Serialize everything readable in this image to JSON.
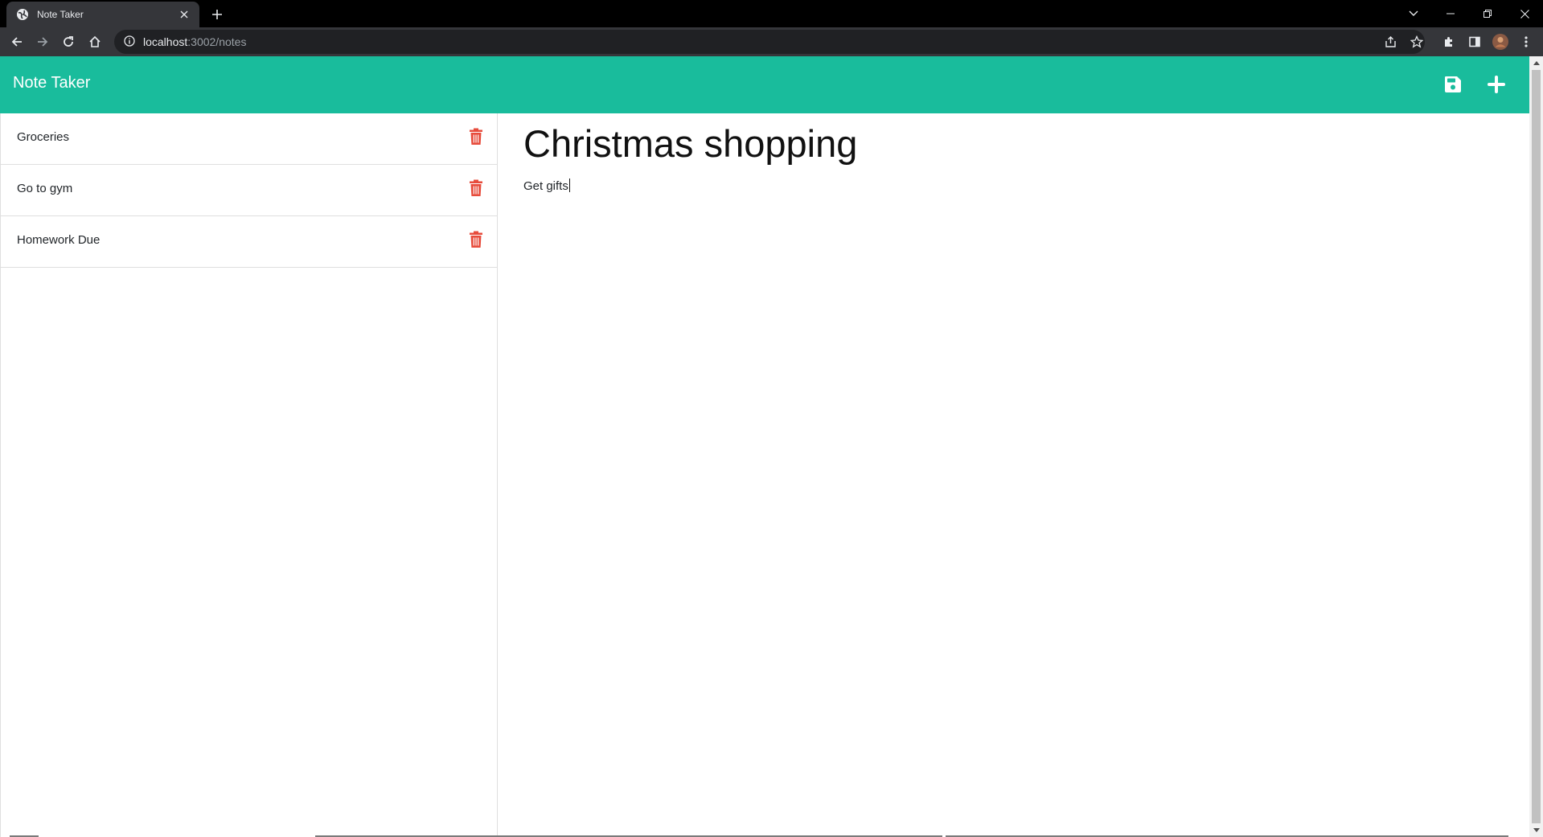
{
  "browser": {
    "tab_title": "Note Taker",
    "url_host": "localhost",
    "url_rest": ":3002/notes"
  },
  "app": {
    "brand": "Note Taker",
    "accent_color": "#19bc9c",
    "delete_color": "#e74c3c"
  },
  "notes": [
    {
      "title": "Groceries"
    },
    {
      "title": "Go to gym"
    },
    {
      "title": "Homework Due"
    }
  ],
  "active_note": {
    "title": "Christmas shopping",
    "text": "Get gifts"
  },
  "icons": {
    "save": "save-icon",
    "new": "plus-icon",
    "delete": "trash-icon"
  }
}
